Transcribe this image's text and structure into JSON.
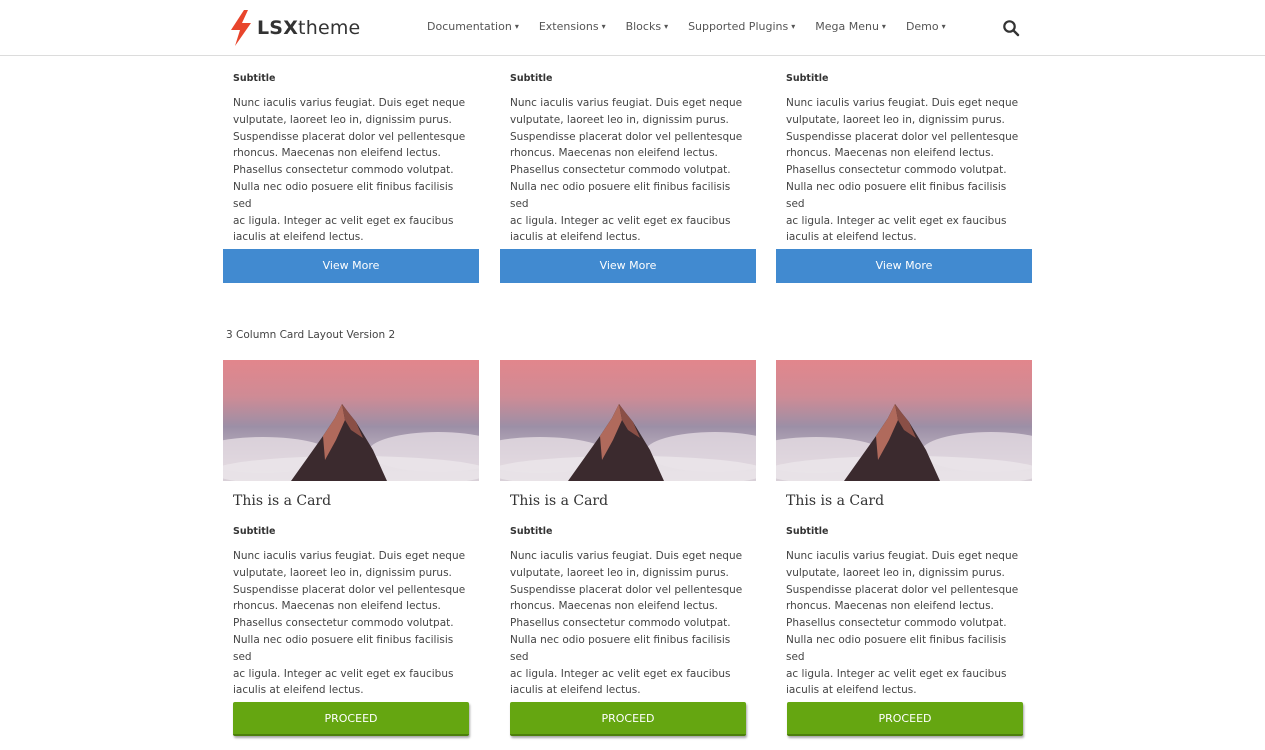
{
  "header": {
    "logo_bold": "LSX",
    "logo_light": "theme",
    "nav": [
      {
        "label": "Documentation"
      },
      {
        "label": "Extensions"
      },
      {
        "label": "Blocks"
      },
      {
        "label": "Supported Plugins"
      },
      {
        "label": "Mega Menu"
      },
      {
        "label": "Demo"
      }
    ]
  },
  "top_cards": [
    {
      "subtitle": "Subtitle",
      "lines": [
        "Nunc iaculis varius feugiat. Duis eget neque",
        "vulputate, laoreet leo in, dignissim purus.",
        "Suspendisse placerat dolor vel pellentesque",
        "rhoncus. Maecenas non eleifend lectus.",
        "Phasellus consectetur commodo volutpat.",
        "Nulla nec odio posuere elit finibus facilisis sed",
        "ac ligula. Integer ac velit eget ex faucibus",
        "iaculis at eleifend lectus."
      ],
      "button": "View More"
    },
    {
      "subtitle": "Subtitle",
      "lines": [
        "Nunc iaculis varius feugiat. Duis eget neque",
        "vulputate, laoreet leo in, dignissim purus.",
        "Suspendisse placerat dolor vel pellentesque",
        "rhoncus. Maecenas non eleifend lectus.",
        "Phasellus consectetur commodo volutpat.",
        "Nulla nec odio posuere elit finibus facilisis sed",
        "ac ligula. Integer ac velit eget ex faucibus",
        "iaculis at eleifend lectus."
      ],
      "button": "View More"
    },
    {
      "subtitle": "Subtitle",
      "lines": [
        "Nunc iaculis varius feugiat. Duis eget neque",
        "vulputate, laoreet leo in, dignissim purus.",
        "Suspendisse placerat dolor vel pellentesque",
        "rhoncus. Maecenas non eleifend lectus.",
        "Phasellus consectetur commodo volutpat.",
        "Nulla nec odio posuere elit finibus facilisis sed",
        "ac ligula. Integer ac velit eget ex faucibus",
        "iaculis at eleifend lectus."
      ],
      "button": "View More"
    }
  ],
  "section_heading": "3 Column Card Layout Version 2",
  "bottom_cards": [
    {
      "title": "This is a Card",
      "subtitle": "Subtitle",
      "lines": [
        "Nunc iaculis varius feugiat. Duis eget neque",
        "vulputate, laoreet leo in, dignissim purus.",
        "Suspendisse placerat dolor vel pellentesque",
        "rhoncus. Maecenas non eleifend lectus.",
        "Phasellus consectetur commodo volutpat.",
        "Nulla nec odio posuere elit finibus facilisis sed",
        "ac ligula. Integer ac velit eget ex faucibus",
        "iaculis at eleifend lectus."
      ],
      "button": "PROCEED"
    },
    {
      "title": "This is a Card",
      "subtitle": "Subtitle",
      "lines": [
        "Nunc iaculis varius feugiat. Duis eget neque",
        "vulputate, laoreet leo in, dignissim purus.",
        "Suspendisse placerat dolor vel pellentesque",
        "rhoncus. Maecenas non eleifend lectus.",
        "Phasellus consectetur commodo volutpat.",
        "Nulla nec odio posuere elit finibus facilisis sed",
        "ac ligula. Integer ac velit eget ex faucibus",
        "iaculis at eleifend lectus."
      ],
      "button": "PROCEED"
    },
    {
      "title": "This is a Card",
      "subtitle": "Subtitle",
      "lines": [
        "Nunc iaculis varius feugiat. Duis eget neque",
        "vulputate, laoreet leo in, dignissim purus.",
        "Suspendisse placerat dolor vel pellentesque",
        "rhoncus. Maecenas non eleifend lectus.",
        "Phasellus consectetur commodo volutpat.",
        "Nulla nec odio posuere elit finibus facilisis sed",
        "ac ligula. Integer ac velit eget ex faucibus",
        "iaculis at eleifend lectus."
      ],
      "button": "PROCEED"
    }
  ],
  "colors": {
    "view_more_button": "#418ad0",
    "proceed_button": "#65a611",
    "logo_bolt": "#e8452c"
  }
}
